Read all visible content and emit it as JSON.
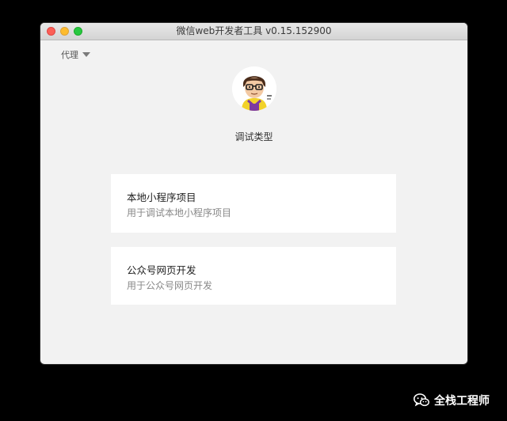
{
  "window": {
    "title": "微信web开发者工具 v0.15.152900"
  },
  "toolbar": {
    "proxy_label": "代理"
  },
  "main": {
    "subtitle": "调试类型",
    "options": [
      {
        "title": "本地小程序项目",
        "description": "用于调试本地小程序项目"
      },
      {
        "title": "公众号网页开发",
        "description": "用于公众号网页开发"
      }
    ]
  },
  "watermark": {
    "text": "全栈工程师"
  },
  "icons": {
    "proxy": "chevron-down-icon",
    "watermark": "wechat-icon",
    "avatar": "user-avatar"
  },
  "colors": {
    "close": "#fc5f57",
    "minimize": "#fdbc2e",
    "zoom": "#28c840",
    "window_bg": "#f2f2f2",
    "card_bg": "#ffffff"
  }
}
